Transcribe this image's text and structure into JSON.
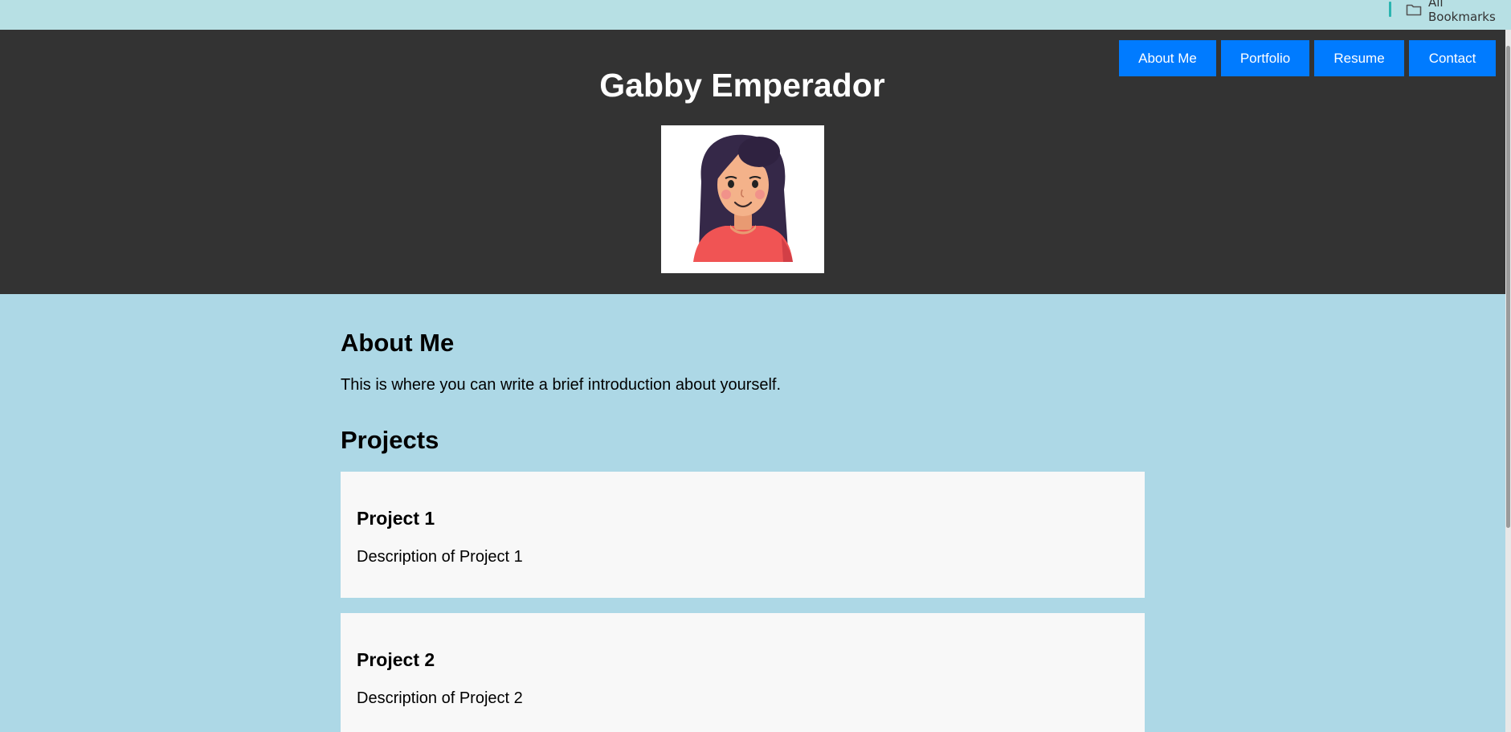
{
  "browser": {
    "bookmarks_label": "All Bookmarks",
    "bookmarks_icon": "folder-icon"
  },
  "header": {
    "title": "Gabby Emperador",
    "avatar_icon": "avatar-illustration"
  },
  "nav": {
    "items": [
      {
        "label": "About Me"
      },
      {
        "label": "Portfolio"
      },
      {
        "label": "Resume"
      },
      {
        "label": "Contact"
      }
    ]
  },
  "about": {
    "heading": "About Me",
    "text": "This is where you can write a brief introduction about yourself."
  },
  "projects": {
    "heading": "Projects",
    "items": [
      {
        "title": "Project 1",
        "description": "Description of Project 1"
      },
      {
        "title": "Project 2",
        "description": "Description of Project 2"
      }
    ]
  },
  "colors": {
    "page_background": "#add8e6",
    "header_background": "#333333",
    "nav_button": "#007bff",
    "card_background": "#f8f8f8"
  }
}
